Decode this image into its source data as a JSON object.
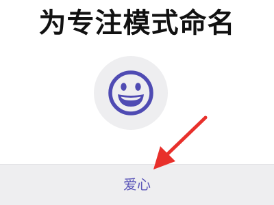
{
  "header": {
    "title": "为专注模式命名"
  },
  "mode_icon": {
    "icon": "smiley-face-icon",
    "color": "#4f4bb3",
    "background": "#eeeef0"
  },
  "name_field": {
    "value": "爱心",
    "text_color": "#5a55b8"
  },
  "annotation": {
    "icon": "red-arrow-icon",
    "color": "#e8302b"
  }
}
